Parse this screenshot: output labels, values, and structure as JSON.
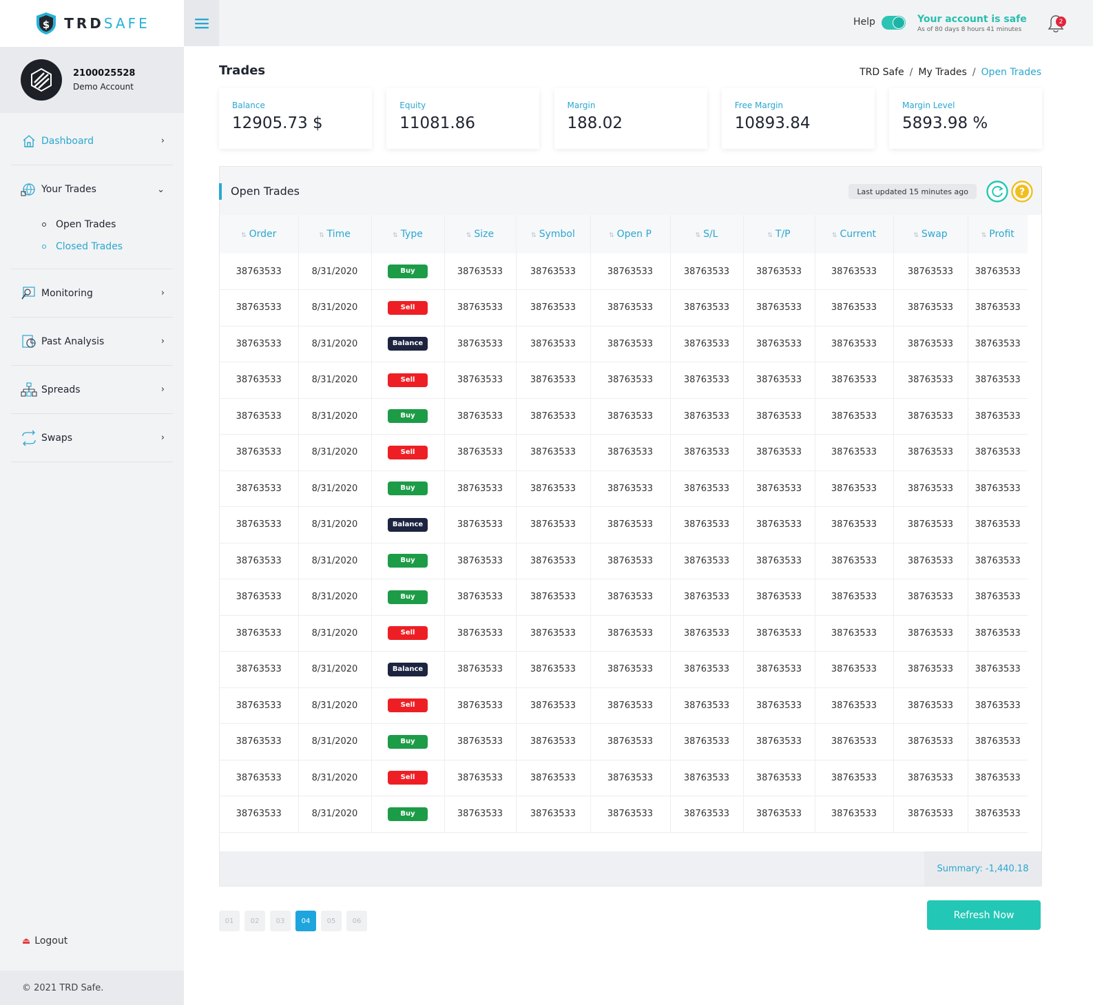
{
  "brand": {
    "logo_main": "TRD",
    "logo_accent": "SAFE"
  },
  "account": {
    "number": "2100025528",
    "type": "Demo Account"
  },
  "sidebar": {
    "items": [
      {
        "label": "Dashboard",
        "icon": "home-icon"
      },
      {
        "label": "Your Trades",
        "icon": "trades-icon"
      },
      {
        "label": "Monitoring",
        "icon": "monitoring-icon"
      },
      {
        "label": "Past Analysis",
        "icon": "analysis-icon"
      },
      {
        "label": "Spreads",
        "icon": "spreads-icon"
      },
      {
        "label": "Swaps",
        "icon": "swaps-icon"
      }
    ],
    "subitems": [
      {
        "label": "Open Trades"
      },
      {
        "label": "Closed Trades"
      }
    ],
    "logout": "Logout",
    "copyright": "© 2021 TRD Safe."
  },
  "header": {
    "help": "Help",
    "safe_title": "Your account is safe",
    "safe_sub": "As of 80 days 8 hours 41 minutes",
    "notifications": "2"
  },
  "page": {
    "title": "Trades",
    "breadcrumb": [
      "TRD Safe",
      "My Trades",
      "Open Trades"
    ]
  },
  "stats": [
    {
      "label": "Balance",
      "value": "12905.73 $"
    },
    {
      "label": "Equity",
      "value": "11081.86"
    },
    {
      "label": "Margin",
      "value": "188.02"
    },
    {
      "label": "Free Margin",
      "value": "10893.84"
    },
    {
      "label": "Margin Level",
      "value": "5893.98 %"
    }
  ],
  "panel": {
    "title": "Open Trades",
    "last_updated": "Last updated 15 minutes ago",
    "summary": "Summary: -1,440.18"
  },
  "table": {
    "columns": [
      "Order",
      "Time",
      "Type",
      "Size",
      "Symbol",
      "Open P",
      "S/L",
      "T/P",
      "Current",
      "Swap",
      "Profit"
    ],
    "rows": [
      [
        "38763533",
        "8/31/2020",
        "Buy",
        "38763533",
        "38763533",
        "38763533",
        "38763533",
        "38763533",
        "38763533",
        "38763533",
        "38763533"
      ],
      [
        "38763533",
        "8/31/2020",
        "Sell",
        "38763533",
        "38763533",
        "38763533",
        "38763533",
        "38763533",
        "38763533",
        "38763533",
        "38763533"
      ],
      [
        "38763533",
        "8/31/2020",
        "Balance",
        "38763533",
        "38763533",
        "38763533",
        "38763533",
        "38763533",
        "38763533",
        "38763533",
        "38763533"
      ],
      [
        "38763533",
        "8/31/2020",
        "Sell",
        "38763533",
        "38763533",
        "38763533",
        "38763533",
        "38763533",
        "38763533",
        "38763533",
        "38763533"
      ],
      [
        "38763533",
        "8/31/2020",
        "Buy",
        "38763533",
        "38763533",
        "38763533",
        "38763533",
        "38763533",
        "38763533",
        "38763533",
        "38763533"
      ],
      [
        "38763533",
        "8/31/2020",
        "Sell",
        "38763533",
        "38763533",
        "38763533",
        "38763533",
        "38763533",
        "38763533",
        "38763533",
        "38763533"
      ],
      [
        "38763533",
        "8/31/2020",
        "Buy",
        "38763533",
        "38763533",
        "38763533",
        "38763533",
        "38763533",
        "38763533",
        "38763533",
        "38763533"
      ],
      [
        "38763533",
        "8/31/2020",
        "Balance",
        "38763533",
        "38763533",
        "38763533",
        "38763533",
        "38763533",
        "38763533",
        "38763533",
        "38763533"
      ],
      [
        "38763533",
        "8/31/2020",
        "Buy",
        "38763533",
        "38763533",
        "38763533",
        "38763533",
        "38763533",
        "38763533",
        "38763533",
        "38763533"
      ],
      [
        "38763533",
        "8/31/2020",
        "Buy",
        "38763533",
        "38763533",
        "38763533",
        "38763533",
        "38763533",
        "38763533",
        "38763533",
        "38763533"
      ],
      [
        "38763533",
        "8/31/2020",
        "Sell",
        "38763533",
        "38763533",
        "38763533",
        "38763533",
        "38763533",
        "38763533",
        "38763533",
        "38763533"
      ],
      [
        "38763533",
        "8/31/2020",
        "Balance",
        "38763533",
        "38763533",
        "38763533",
        "38763533",
        "38763533",
        "38763533",
        "38763533",
        "38763533"
      ],
      [
        "38763533",
        "8/31/2020",
        "Sell",
        "38763533",
        "38763533",
        "38763533",
        "38763533",
        "38763533",
        "38763533",
        "38763533",
        "38763533"
      ],
      [
        "38763533",
        "8/31/2020",
        "Buy",
        "38763533",
        "38763533",
        "38763533",
        "38763533",
        "38763533",
        "38763533",
        "38763533",
        "38763533"
      ],
      [
        "38763533",
        "8/31/2020",
        "Sell",
        "38763533",
        "38763533",
        "38763533",
        "38763533",
        "38763533",
        "38763533",
        "38763533",
        "38763533"
      ],
      [
        "38763533",
        "8/31/2020",
        "Buy",
        "38763533",
        "38763533",
        "38763533",
        "38763533",
        "38763533",
        "38763533",
        "38763533",
        "38763533"
      ]
    ]
  },
  "pagination": {
    "pages": [
      "01",
      "02",
      "03",
      "04",
      "05",
      "06"
    ],
    "active": "04"
  },
  "refresh_button": "Refresh Now",
  "colors": {
    "accent": "#2aa7cf",
    "teal": "#23c7b5",
    "buy": "#1c9c47",
    "sell": "#ee1f24",
    "balance": "#1c2440"
  }
}
